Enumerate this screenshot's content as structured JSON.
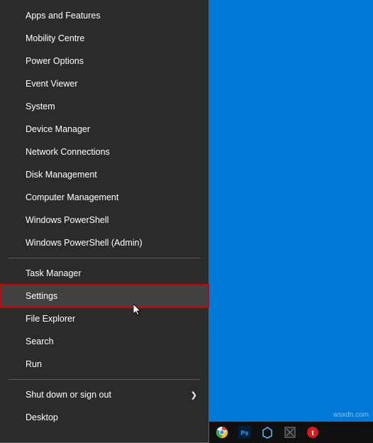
{
  "menu": {
    "group1": [
      {
        "label": "Apps and Features"
      },
      {
        "label": "Mobility Centre"
      },
      {
        "label": "Power Options"
      },
      {
        "label": "Event Viewer"
      },
      {
        "label": "System"
      },
      {
        "label": "Device Manager"
      },
      {
        "label": "Network Connections"
      },
      {
        "label": "Disk Management"
      },
      {
        "label": "Computer Management"
      },
      {
        "label": "Windows PowerShell"
      },
      {
        "label": "Windows PowerShell (Admin)"
      }
    ],
    "group2": [
      {
        "label": "Task Manager"
      },
      {
        "label": "Settings"
      },
      {
        "label": "File Explorer"
      },
      {
        "label": "Search"
      },
      {
        "label": "Run"
      }
    ],
    "group3": [
      {
        "label": "Shut down or sign out"
      },
      {
        "label": "Desktop"
      }
    ]
  },
  "highlighted_item": "Settings",
  "submenu_item": "Shut down or sign out",
  "watermark": "wsxdn.com",
  "taskbar": {
    "icons": [
      "chrome",
      "photoshop",
      "app1",
      "app2",
      "trend"
    ]
  },
  "colors": {
    "menu_bg": "#2b2b2b",
    "desktop": "#0078d7",
    "highlight_border": "#d00000"
  }
}
